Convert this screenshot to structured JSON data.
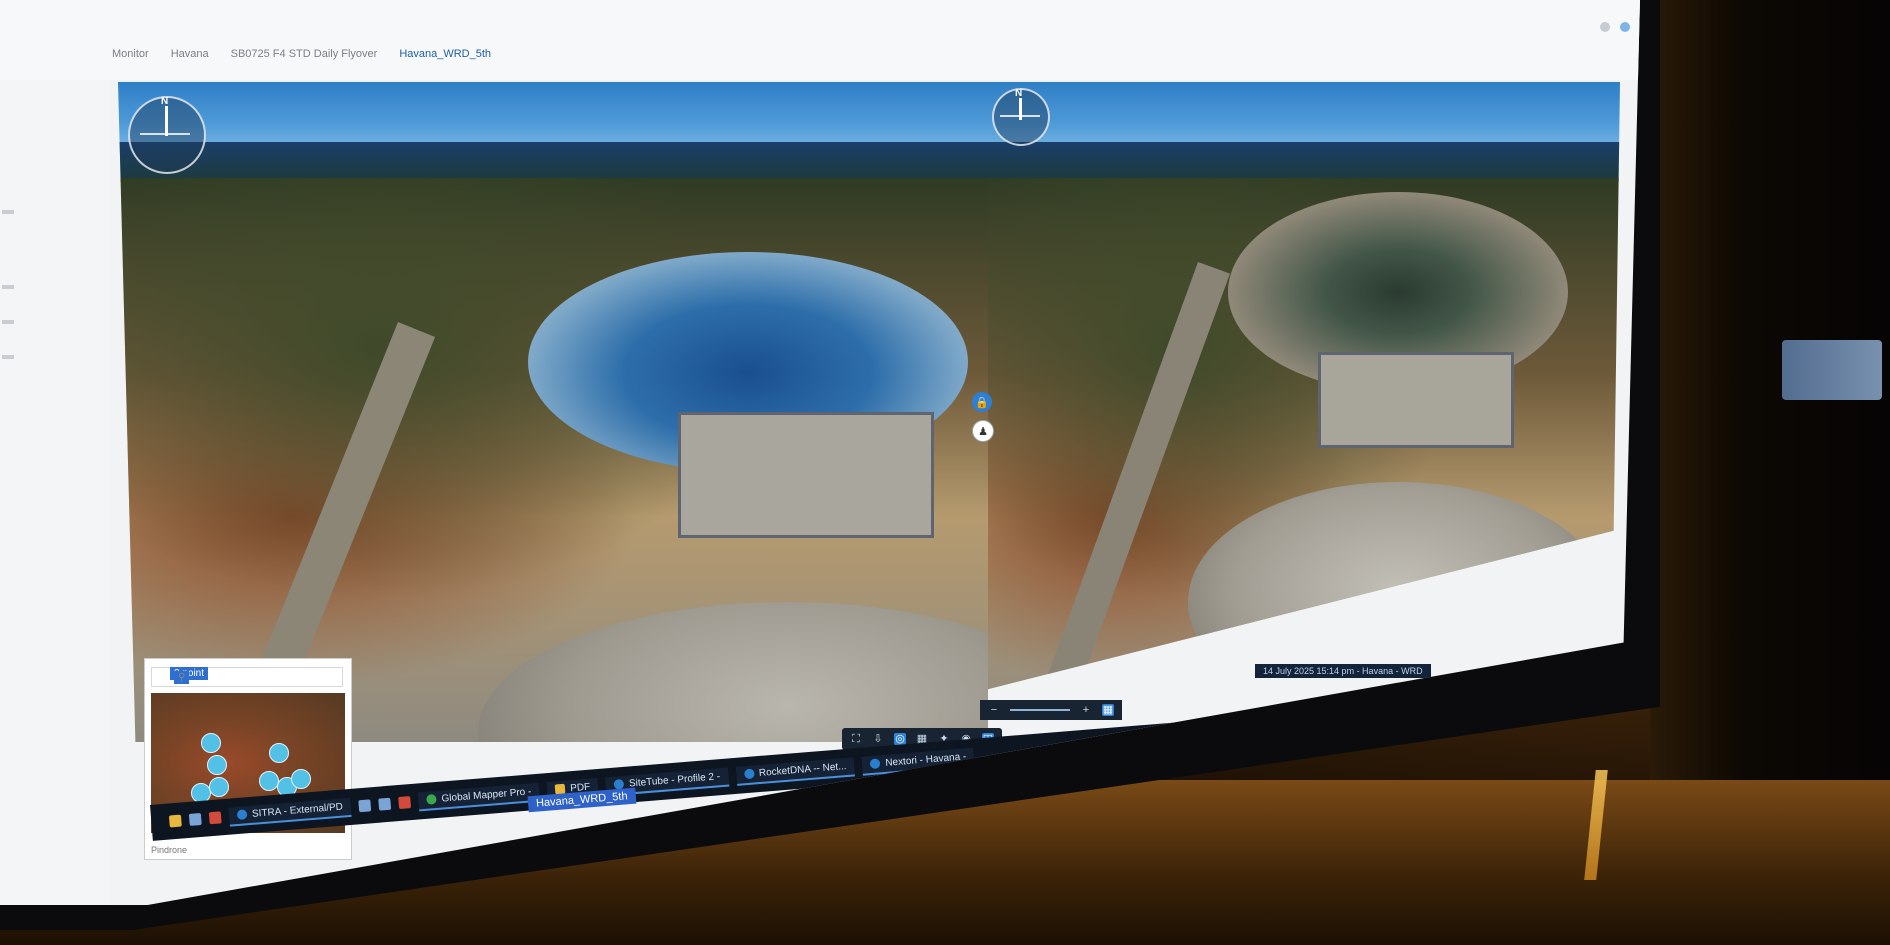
{
  "breadcrumb": [
    "Monitor",
    "Havana",
    "SB0725 F4 STD Daily Flyover",
    "Havana_WRD_5th"
  ],
  "viewer_left": {
    "compass_label": "N"
  },
  "viewer_right": {
    "compass_label": "N"
  },
  "minimap": {
    "search_value": "2 point",
    "footer": "Pindrone"
  },
  "status_strip": "14 July 2025  15:14 pm - Havana - WRD",
  "active_tab": "Havana_WRD_5th",
  "taskbar": {
    "apps": [
      {
        "label": "SITRA - External/PD",
        "icon": "edge-icon"
      },
      {
        "label": "Global Mapper Pro -",
        "icon": "globe-icon"
      },
      {
        "label": "PDF",
        "icon": "pdf-icon"
      },
      {
        "label": "SiteTube - Profile 2 -",
        "icon": "edge-icon"
      },
      {
        "label": "RocketDNA -- Net...",
        "icon": "edge-icon"
      },
      {
        "label": "Nextori - Havana -",
        "icon": "edge-icon"
      }
    ]
  },
  "colors": {
    "accent": "#2e7fd4",
    "taskbar": "#0d1521",
    "sky": "#4f9ad8"
  }
}
